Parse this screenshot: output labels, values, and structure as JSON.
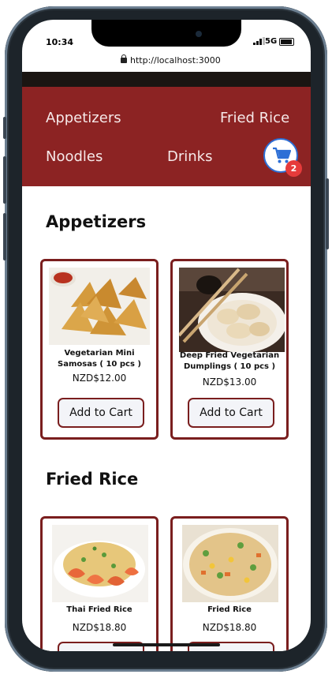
{
  "status_bar": {
    "time": "10:34",
    "network": "5G"
  },
  "browser": {
    "url": "http://localhost:3000"
  },
  "nav": {
    "links": [
      "Appetizers",
      "Fried Rice",
      "Noodles",
      "Drinks"
    ],
    "cart_count": "2",
    "cart_icon": "shopping-cart-icon"
  },
  "sections": [
    {
      "title": "Appetizers",
      "items": [
        {
          "name": "Vegetarian Mini Samosas ( 10 pcs )",
          "price": "NZD$12.00",
          "button": "Add to Cart"
        },
        {
          "name": "Deep Fried Vegetarian Dumplings ( 10 pcs )",
          "price": "NZD$13.00",
          "button": "Add to Cart"
        }
      ]
    },
    {
      "title": "Fried Rice",
      "items": [
        {
          "name": "Thai Fried Rice",
          "price": "NZD$18.80",
          "button": ""
        },
        {
          "name": "Fried Rice",
          "price": "NZD$18.80",
          "button": ""
        }
      ]
    }
  ],
  "colors": {
    "brand": "#8c2323",
    "card_border": "#7a1e1e",
    "badge": "#e63b3b",
    "cart_ring": "#2d6fd6"
  }
}
